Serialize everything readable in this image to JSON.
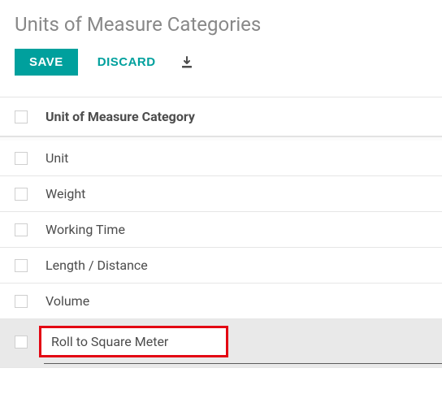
{
  "title": "Units of Measure Categories",
  "toolbar": {
    "save_label": "SAVE",
    "discard_label": "DISCARD"
  },
  "table": {
    "header": "Unit of Measure Category",
    "rows": [
      {
        "name": "Unit"
      },
      {
        "name": "Weight"
      },
      {
        "name": "Working Time"
      },
      {
        "name": "Length / Distance"
      },
      {
        "name": "Volume"
      }
    ],
    "editing_value": "Roll to Square Meter"
  }
}
